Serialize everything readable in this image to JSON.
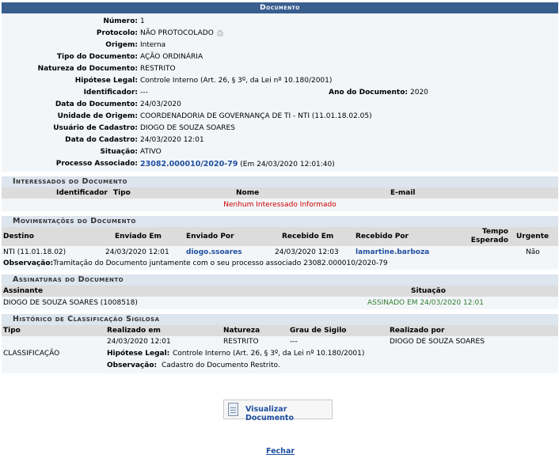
{
  "title": "Documento",
  "fields": [
    {
      "label": "Número:",
      "value": "1"
    },
    {
      "label": "Protocolo:",
      "value": "NÃO PROTOCOLADO"
    },
    {
      "label": "Origem:",
      "value": "Interna"
    },
    {
      "label": "Tipo do Documento:",
      "value": "AÇÃO ORDINÁRIA"
    },
    {
      "label": "Natureza do Documento:",
      "value": "RESTRITO"
    },
    {
      "label": "Hipótese Legal:",
      "value": "Controle Interno (Art. 26, § 3º, da Lei nº 10.180/2001)"
    },
    {
      "label": "Identificador:",
      "value": "---"
    },
    {
      "label": "Data do Documento:",
      "value": "24/03/2020"
    },
    {
      "label": "Unidade de Origem:",
      "value": "COORDENADORIA DE GOVERNANÇA DE TI - NTI (11.01.18.02.05)"
    },
    {
      "label": "Usuário de Cadastro:",
      "value": "DIOGO DE SOUZA SOARES"
    },
    {
      "label": "Data do Cadastro:",
      "value": "24/03/2020 12:01"
    },
    {
      "label": "Situação:",
      "value": "ATIVO"
    },
    {
      "label": "Processo Associado:",
      "value": "23082.000010/2020-79",
      "extra": "(Em 24/03/2020 12:01:40)"
    }
  ],
  "ano": {
    "label": "Ano do Documento:",
    "value": "2020"
  },
  "interessados": {
    "title": "Interessados do Documento",
    "headers": {
      "identificador": "Identificador",
      "tipo": "Tipo",
      "nome": "Nome",
      "email": "E-mail"
    },
    "empty": "Nenhum Interessado Informado"
  },
  "movimentacoes": {
    "title": "Movimentações do Documento",
    "headers": {
      "destino": "Destino",
      "enviado_em": "Enviado Em",
      "enviado_por": "Enviado Por",
      "recebido_em": "Recebido Em",
      "recebido_por": "Recebido Por",
      "tempo": "Tempo Esperado",
      "urgente": "Urgente"
    },
    "row": {
      "destino": "NTI (11.01.18.02)",
      "enviado_em": "24/03/2020 12:01",
      "enviado_por": "diogo.ssoares",
      "recebido_em": "24/03/2020 12:03",
      "recebido_por": "lamartine.barboza",
      "urgente": "Não"
    },
    "obs_label": "Observação:",
    "obs_value": "Tramitação do Documento juntamente com o seu processo associado 23082.000010/2020-79"
  },
  "assinaturas": {
    "title": "Assinaturas do Documento",
    "headers": {
      "assinante": "Assinante",
      "situacao": "Situação"
    },
    "row": {
      "assinante": "DIOGO DE SOUZA SOARES (1008518)",
      "situacao": "ASSINADO EM 24/03/2020 12:01"
    }
  },
  "historico": {
    "title": "Histórico de Classificação Sigilosa",
    "headers": {
      "tipo": "Tipo",
      "realizado_em": "Realizado em",
      "natureza": "Natureza",
      "grau": "Grau de Sigilo",
      "realizado_por": "Realizado por"
    },
    "row": {
      "tipo": "CLASSIFICAÇÃO",
      "realizado_em": "24/03/2020 12:01",
      "natureza": "RESTRITO",
      "grau": "---",
      "realizado_por": "DIOGO DE SOUZA SOARES"
    },
    "hip_label": "Hipótese Legal:",
    "hip_value": "Controle Interno (Art. 26, § 3º, da Lei nº 10.180/2001)",
    "obs_label": "Observação:",
    "obs_value": "Cadastro do Documento Restrito."
  },
  "buttons": {
    "visualizar": "Visualizar Documento",
    "fechar": "Fechar"
  },
  "colors": {
    "header": "#3a5f8f",
    "section": "#dde5ee",
    "link": "#1f4fa0"
  }
}
